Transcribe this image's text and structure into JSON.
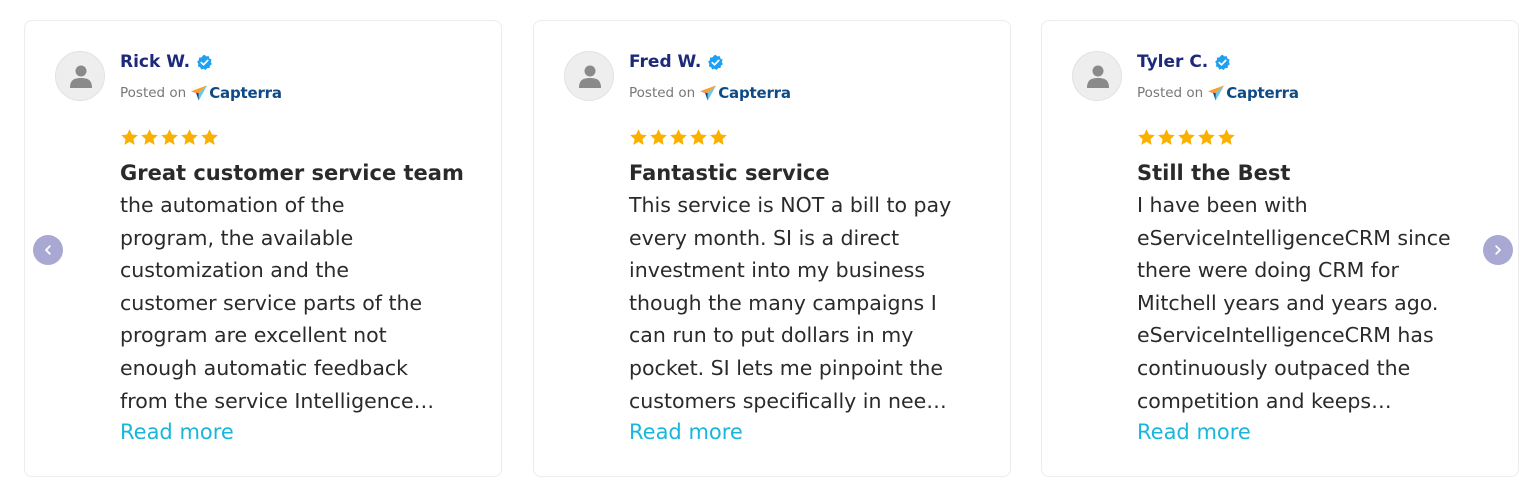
{
  "carousel": {
    "prev_icon": "chevron-left-icon",
    "next_icon": "chevron-right-icon",
    "nav_color": "#a8a8d3"
  },
  "colors": {
    "name": "#1d2a7a",
    "verified": "#1da1f2",
    "star": "#f9b000",
    "read_more": "#19b6dc",
    "capterra_brand": "#0e4a86"
  },
  "reviews": [
    {
      "name": "Rick W.",
      "posted_label": "Posted on",
      "platform": "Capterra",
      "rating": 5,
      "title": "Great customer service team",
      "body": "the automation of the\nprogram, the available\ncustomization and the\ncustomer service parts of the\nprogram are excellent not\nenough automatic feedback\nfrom the service Intelligence…",
      "read_more": "Read more"
    },
    {
      "name": "Fred W.",
      "posted_label": "Posted on",
      "platform": "Capterra",
      "rating": 5,
      "title": "Fantastic service",
      "body": "This service is NOT a bill to pay\nevery month. SI is a direct\ninvestment into my business\nthough the many campaigns I\ncan run to put dollars in my\npocket. SI lets me pinpoint the\ncustomers specifically in nee…",
      "read_more": "Read more"
    },
    {
      "name": "Tyler C.",
      "posted_label": "Posted on",
      "platform": "Capterra",
      "rating": 5,
      "title": "Still the Best",
      "body": "I have been with\neServiceIntelligenceCRM since\nthere were doing CRM for\nMitchell years and years ago.\neServiceIntelligenceCRM has\ncontinuously outpaced the\ncompetition and keeps…",
      "read_more": "Read more"
    }
  ]
}
